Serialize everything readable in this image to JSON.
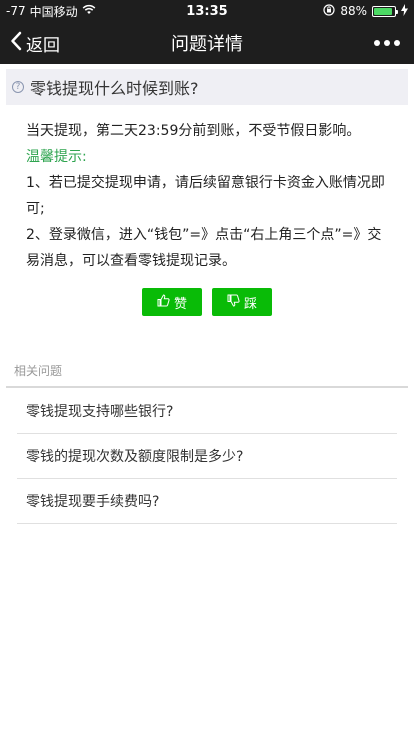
{
  "status_bar": {
    "signal": "-77",
    "carrier": "中国移动",
    "time": "13:35",
    "battery_percent": "88%",
    "battery_level": 0.88
  },
  "nav": {
    "back_label": "返回",
    "title": "问题详情"
  },
  "question": {
    "icon": "?",
    "title": "零钱提现什么时候到账?"
  },
  "answer": {
    "line1": "当天提现，第二天23:59分前到账，不受节假日影响。",
    "tip_label": "温馨提示:",
    "tip1": "1、若已提交提现申请，请后续留意银行卡资金入账情况即可;",
    "tip2": "2、登录微信，进入“钱包”=》点击“右上角三个点”=》交易消息，可以查看零钱提现记录。"
  },
  "vote": {
    "like_label": "赞",
    "dislike_label": "踩"
  },
  "related": {
    "label": "相关问题",
    "items": [
      "零钱提现支持哪些银行?",
      "零钱的提现次数及额度限制是多少?",
      "零钱提现要手续费吗?"
    ]
  }
}
